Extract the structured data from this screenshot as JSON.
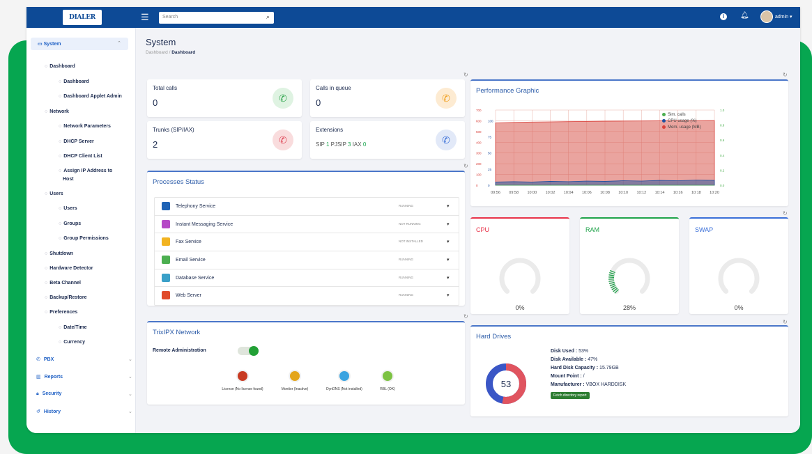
{
  "topbar": {
    "logo_text": "DIALER",
    "search_placeholder": "Search",
    "user": "admin ▾"
  },
  "sidebar": {
    "system": "System",
    "items": [
      {
        "label": "Dashboard",
        "level": 1
      },
      {
        "label": "Dashboard",
        "level": 2
      },
      {
        "label": "Dashboard Applet Admin",
        "level": 2
      },
      {
        "label": "Network",
        "level": 1
      },
      {
        "label": "Network Parameters",
        "level": 2
      },
      {
        "label": "DHCP Server",
        "level": 2
      },
      {
        "label": "DHCP Client List",
        "level": 2
      },
      {
        "label": "Assign IP Address to",
        "level": 2
      },
      {
        "label": "Host",
        "level": 3
      },
      {
        "label": "Users",
        "level": 1
      },
      {
        "label": "Users",
        "level": 2
      },
      {
        "label": "Groups",
        "level": 2
      },
      {
        "label": "Group Permissions",
        "level": 2
      },
      {
        "label": "Shutdown",
        "level": 1
      },
      {
        "label": "Hardware Detector",
        "level": 1
      },
      {
        "label": "Beta Channel",
        "level": 1
      },
      {
        "label": "Backup/Restore",
        "level": 1
      },
      {
        "label": "Preferences",
        "level": 1
      },
      {
        "label": "Date/Time",
        "level": 2
      },
      {
        "label": "Currency",
        "level": 2
      }
    ],
    "main_items": [
      "PBX",
      "Reports",
      "Security",
      "History"
    ]
  },
  "page": {
    "title": "System",
    "crumb_root": "Dashboard",
    "crumb_current": "Dashboard"
  },
  "stats": {
    "total_calls": {
      "label": "Total calls",
      "value": "0"
    },
    "calls_in_queue": {
      "label": "Calls in queue",
      "value": "0"
    },
    "trunks": {
      "label": "Trunks (SIP/IAX)",
      "value": "2"
    },
    "extensions": {
      "label": "Extensions",
      "sip_label": "SIP",
      "sip": "1",
      "pjsip_label": "PJSIP",
      "pjsip": "3",
      "iax_label": "IAX",
      "iax": "0"
    }
  },
  "processes": {
    "title": "Processes Status",
    "items": [
      {
        "name": "Telephony Service",
        "status": "RUNNING",
        "color": "#1f63b5"
      },
      {
        "name": "Instant Messaging Service",
        "status": "NOT RUNNING",
        "color": "#b548c6"
      },
      {
        "name": "Fax Service",
        "status": "NOT INSTALLED",
        "color": "#f2b320"
      },
      {
        "name": "Email Service",
        "status": "RUNNING",
        "color": "#4caf50"
      },
      {
        "name": "Database Service",
        "status": "RUNNING",
        "color": "#3aa0c8"
      },
      {
        "name": "Web Server",
        "status": "RUNNING",
        "color": "#e04a2a"
      }
    ]
  },
  "network": {
    "title": "TrixIPX Network",
    "remote_admin": "Remote Administration",
    "leds": [
      {
        "label": "License (No license found)",
        "color": "#c83a22"
      },
      {
        "label": "Monitor (Inactive)",
        "color": "#e3a51c"
      },
      {
        "label": "DynDNS (Not installed)",
        "color": "#3aa3e0"
      },
      {
        "label": "RBL (OK)",
        "color": "#7cc242"
      }
    ]
  },
  "performance": {
    "title": "Performance Graphic",
    "legend": [
      {
        "label": "Sim. calls",
        "color": "#4caf50"
      },
      {
        "label": "CPU usage (%)",
        "color": "#1d4fa0"
      },
      {
        "label": "Mem. usage (MB)",
        "color": "#d9403a"
      }
    ]
  },
  "chart_data": {
    "type": "area",
    "x": [
      "09:56",
      "09:58",
      "10:00",
      "10:02",
      "10:04",
      "10:06",
      "10:08",
      "10:10",
      "10:12",
      "10:14",
      "10:16",
      "10:18",
      "10:20"
    ],
    "left_ticks": [
      "700",
      "600",
      "500",
      "400",
      "300",
      "200",
      "100",
      "0"
    ],
    "mid_ticks": [
      "100",
      "75",
      "50",
      "25",
      "0"
    ],
    "right_ticks": [
      "1.0",
      "0.8",
      "0.6",
      "0.4",
      "0.2",
      "0.0"
    ],
    "ylim": [
      0,
      700
    ],
    "series": [
      {
        "name": "Mem. usage (MB)",
        "values": [
          580,
          585,
          588,
          590,
          592,
          594,
          596,
          597,
          598,
          599,
          600,
          601,
          602
        ]
      },
      {
        "name": "CPU usage (%)",
        "values": [
          10,
          11,
          10,
          12,
          11,
          13,
          12,
          14,
          13,
          15,
          14,
          16,
          15
        ]
      },
      {
        "name": "Sim. calls",
        "values": [
          0,
          0,
          0,
          0,
          0,
          0,
          0,
          0,
          0,
          0,
          0,
          0,
          0
        ]
      }
    ]
  },
  "resources": {
    "cpu": {
      "label": "CPU",
      "value": "0%",
      "fraction": 0,
      "color": "#e8334a"
    },
    "ram": {
      "label": "RAM",
      "value": "28%",
      "fraction": 0.28,
      "color": "#1fa34a"
    },
    "swap": {
      "label": "SWAP",
      "value": "0%",
      "fraction": 0,
      "color": "#3a6fd8"
    }
  },
  "hard_drives": {
    "title": "Hard Drives",
    "center": "53",
    "used_fraction": 0.53,
    "used_label": "Disk Used :",
    "used": "53%",
    "avail_label": "Disk Available :",
    "avail": "47%",
    "cap_label": "Hard Disk Capacity :",
    "cap": "15.79GB",
    "mount_label": "Mount Point :",
    "mount": "/",
    "mfr_label": "Manufacturer :",
    "mfr": "VBOX HARDDISK",
    "button": "Fetch directory report"
  }
}
